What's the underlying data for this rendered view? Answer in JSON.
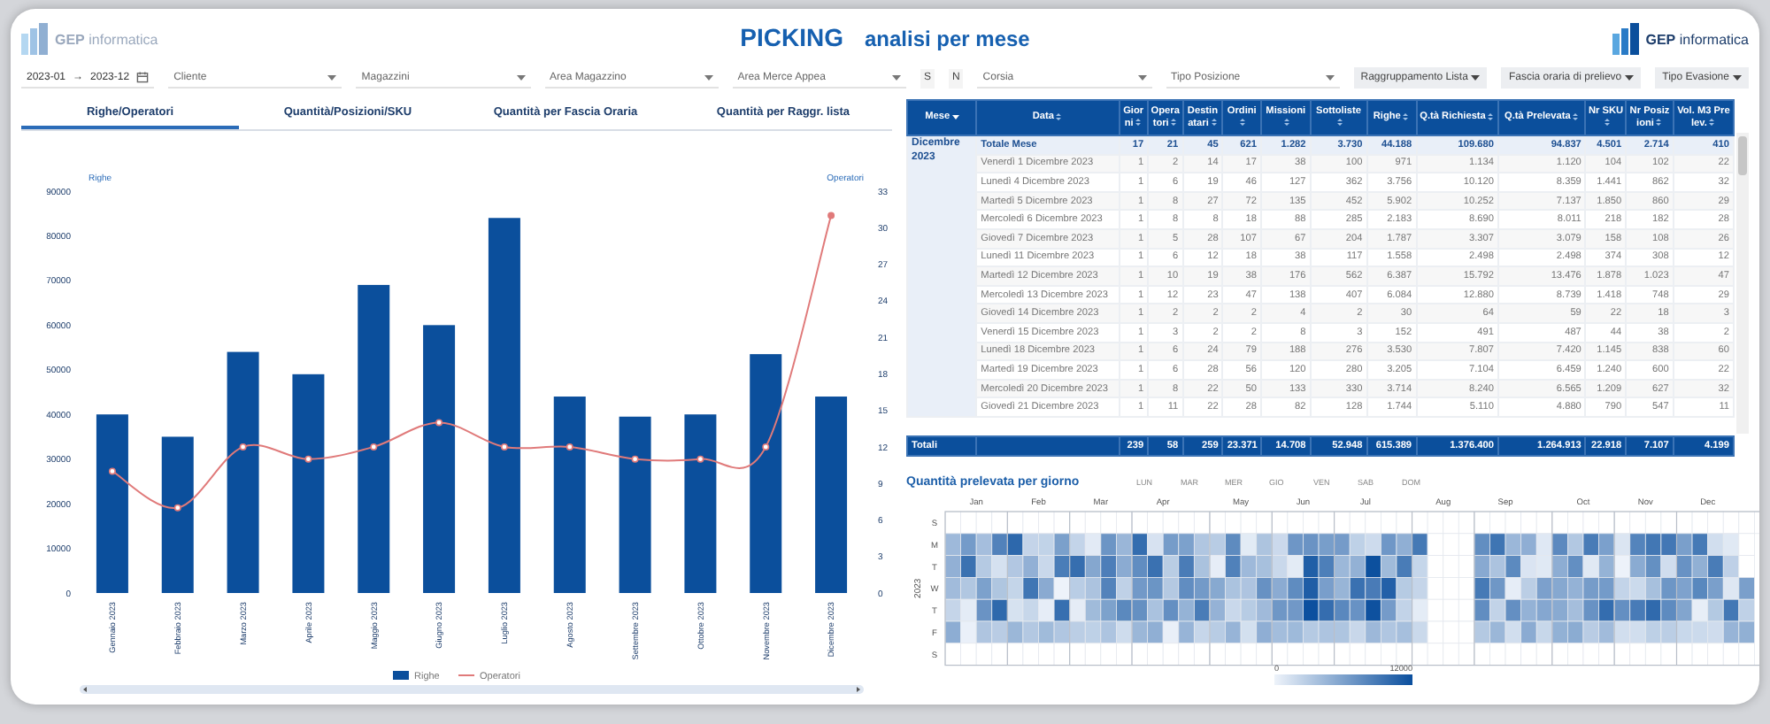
{
  "header": {
    "logo_left": "**GEP** informatica",
    "title": "PICKING",
    "subtitle": "analisi per mese",
    "logo_right": "**GEP** informatica"
  },
  "filters": [
    {
      "kind": "daterange",
      "from": "2023-01",
      "separator": "→",
      "to": "2023-12"
    },
    {
      "kind": "select",
      "placeholder": "Cliente"
    },
    {
      "kind": "select",
      "placeholder": "Magazzini"
    },
    {
      "kind": "select",
      "placeholder": "Area Magazzino"
    },
    {
      "kind": "select",
      "placeholder": "Area Merce Appea"
    },
    {
      "kind": "toggle",
      "label": "S"
    },
    {
      "kind": "toggle",
      "label": "N"
    },
    {
      "kind": "select",
      "placeholder": "Corsia"
    },
    {
      "kind": "select",
      "placeholder": "Tipo Posizione"
    },
    {
      "kind": "menu",
      "label": "Raggruppamento Lista"
    },
    {
      "kind": "menu",
      "label": "Fascia oraria di prelievo"
    },
    {
      "kind": "menu",
      "label": "Tipo Evasione"
    }
  ],
  "tabs": [
    {
      "label": "Righe/Operatori",
      "selected": true
    },
    {
      "label": "Quantità/Posizioni/SKU",
      "selected": false
    },
    {
      "label": "Quantità per Fascia Oraria",
      "selected": false
    },
    {
      "label": "Quantità per Raggr. lista",
      "selected": false
    }
  ],
  "chart": {
    "layers": [
      {
        "chart_data": {
          "type": "bar",
          "ylabel": "Righe",
          "categories": [
            "Gennaio 2023",
            "Febbraio 2023",
            "Marzo 2023",
            "Aprile 2023",
            "Maggio 2023",
            "Giugno 2023",
            "Luglio 2023",
            "Agosto 2023",
            "Settembre 2023",
            "Ottobre 2023",
            "Novembre 2023",
            "Dicembre 2023"
          ],
          "series": [
            {
              "name": "Righe",
              "color": "#0b4f9c",
              "values": [
                40000,
                35000,
                54000,
                49000,
                69000,
                60000,
                84000,
                44000,
                39500,
                40000,
                53500,
                44000
              ]
            }
          ],
          "ylim": [
            0,
            90000
          ],
          "yticks": [
            0,
            10000,
            20000,
            30000,
            40000,
            50000,
            60000,
            70000,
            80000,
            90000
          ]
        }
      },
      {
        "chart_data": {
          "type": "line",
          "ylabel": "Operatori",
          "series": [
            {
              "name": "Operatori",
              "color": "#e07a7a",
              "marker": "circle",
              "values": [
                10,
                7,
                12,
                11,
                12,
                14,
                12,
                12,
                11,
                11,
                12,
                31
              ]
            }
          ],
          "ylim": [
            0,
            33
          ],
          "yticks": [
            0,
            3,
            6,
            9,
            12,
            15,
            18,
            21,
            24,
            27,
            30,
            33
          ]
        }
      }
    ]
  },
  "table": {
    "columns": [
      "Mese",
      "Data",
      "Giorni",
      "Operatori",
      "Destinatari",
      "Ordini",
      "Missioni",
      "Sottoliste",
      "Righe",
      "Q.tà Richiesta",
      "Q.tà Prelevata",
      "Nr SKU",
      "Nr Posizioni",
      "Vol. M3 Prelev."
    ],
    "group": "Dicembre 2023",
    "rows": [
      {
        "kind": "subtotal",
        "date": "Totale Mese",
        "values": [
          "17",
          "21",
          "45",
          "621",
          "1.282",
          "3.730",
          "44.188",
          "109.680",
          "94.837",
          "4.501",
          "2.714",
          "410"
        ]
      },
      {
        "kind": "day",
        "date": "Venerdì 1 Dicembre 2023",
        "values": [
          "1",
          "2",
          "14",
          "17",
          "38",
          "100",
          "971",
          "1.134",
          "1.120",
          "104",
          "102",
          "22"
        ]
      },
      {
        "kind": "day",
        "date": "Lunedì 4 Dicembre 2023",
        "values": [
          "1",
          "6",
          "19",
          "46",
          "127",
          "362",
          "3.756",
          "10.120",
          "8.359",
          "1.441",
          "862",
          "32"
        ]
      },
      {
        "kind": "day",
        "date": "Martedì 5 Dicembre 2023",
        "values": [
          "1",
          "8",
          "27",
          "72",
          "135",
          "452",
          "5.902",
          "10.252",
          "7.137",
          "1.850",
          "860",
          "29"
        ]
      },
      {
        "kind": "day",
        "date": "Mercoledì 6 Dicembre 2023",
        "values": [
          "1",
          "8",
          "8",
          "18",
          "88",
          "285",
          "2.183",
          "8.690",
          "8.011",
          "218",
          "182",
          "28"
        ]
      },
      {
        "kind": "day",
        "date": "Giovedì 7 Dicembre 2023",
        "values": [
          "1",
          "5",
          "28",
          "107",
          "67",
          "204",
          "1.787",
          "3.307",
          "3.079",
          "158",
          "108",
          "26"
        ]
      },
      {
        "kind": "day",
        "date": "Lunedì 11 Dicembre 2023",
        "values": [
          "1",
          "6",
          "12",
          "18",
          "38",
          "117",
          "1.558",
          "2.498",
          "2.498",
          "374",
          "308",
          "12"
        ]
      },
      {
        "kind": "day",
        "date": "Martedì 12 Dicembre 2023",
        "values": [
          "1",
          "10",
          "19",
          "38",
          "176",
          "562",
          "6.387",
          "15.792",
          "13.476",
          "1.878",
          "1.023",
          "47"
        ]
      },
      {
        "kind": "day",
        "date": "Mercoledì 13 Dicembre 2023",
        "values": [
          "1",
          "12",
          "23",
          "47",
          "138",
          "407",
          "6.084",
          "12.880",
          "8.739",
          "1.418",
          "748",
          "29"
        ]
      },
      {
        "kind": "day",
        "date": "Giovedì 14 Dicembre 2023",
        "values": [
          "1",
          "2",
          "2",
          "2",
          "4",
          "2",
          "30",
          "64",
          "59",
          "22",
          "18",
          "3"
        ]
      },
      {
        "kind": "day",
        "date": "Venerdì 15 Dicembre 2023",
        "values": [
          "1",
          "3",
          "2",
          "2",
          "8",
          "3",
          "152",
          "491",
          "487",
          "44",
          "38",
          "2"
        ]
      },
      {
        "kind": "day",
        "date": "Lunedì 18 Dicembre 2023",
        "values": [
          "1",
          "6",
          "24",
          "79",
          "188",
          "276",
          "3.530",
          "7.807",
          "7.420",
          "1.145",
          "838",
          "60"
        ]
      },
      {
        "kind": "day",
        "date": "Martedì 19 Dicembre 2023",
        "values": [
          "1",
          "6",
          "28",
          "56",
          "120",
          "280",
          "3.205",
          "7.104",
          "6.459",
          "1.240",
          "600",
          "22"
        ]
      },
      {
        "kind": "day",
        "date": "Mercoledì 20 Dicembre 2023",
        "values": [
          "1",
          "8",
          "22",
          "50",
          "133",
          "330",
          "3.714",
          "8.240",
          "6.565",
          "1.209",
          "627",
          "32"
        ]
      },
      {
        "kind": "day",
        "date": "Giovedì 21 Dicembre 2023",
        "values": [
          "1",
          "11",
          "22",
          "28",
          "82",
          "128",
          "1.744",
          "5.110",
          "4.880",
          "790",
          "547",
          "11"
        ]
      }
    ],
    "totals": {
      "label": "Totali",
      "values": [
        "239",
        "58",
        "259",
        "23.371",
        "14.708",
        "52.948",
        "615.389",
        "1.376.400",
        "1.264.913",
        "22.918",
        "7.107",
        "4.199"
      ]
    }
  },
  "heatmap": {
    "title": "Quantità prelevata per giorno",
    "legend": [
      "LUN",
      "MAR",
      "MER",
      "GIO",
      "VEN",
      "SAB",
      "DOM"
    ],
    "months": [
      "Jan",
      "Feb",
      "Mar",
      "Apr",
      "May",
      "Jun",
      "Jul",
      "Aug",
      "Sep",
      "Oct",
      "Nov",
      "Dec"
    ],
    "day_labels": [
      "S",
      "M",
      "T",
      "W",
      "T",
      "F",
      "S"
    ],
    "year": "2023",
    "scale_min": "0",
    "scale_max": "12000"
  }
}
